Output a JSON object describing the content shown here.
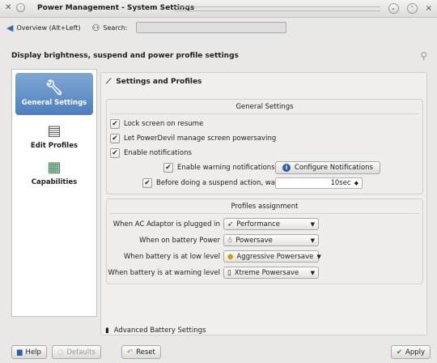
{
  "window": {
    "title": "Power Management - System Settings",
    "kde_icon": "kde-gear-icon",
    "pin_icon": "pin-icon",
    "minimize_symbol": "⌄",
    "maximize_symbol": "⌃",
    "close_symbol": "×"
  },
  "toolbar": {
    "overview_label": "Overview (Alt+Left)",
    "search_label": "Search:",
    "search_value": ""
  },
  "header": {
    "description": "Display brightness, suspend and power profile settings"
  },
  "sidebar": {
    "items": [
      {
        "label": "General Settings",
        "icon": "wrench-icon",
        "active": true
      },
      {
        "label": "Edit Profiles",
        "icon": "document-icon",
        "active": false
      },
      {
        "label": "Capabilities",
        "icon": "hardware-icon",
        "active": false
      }
    ]
  },
  "main": {
    "section_title": "Settings and Profiles",
    "general": {
      "title": "General Settings",
      "lock_screen": "Lock screen on resume",
      "powerdevil": "Let PowerDevil manage screen powersaving",
      "notifications": "Enable notifications",
      "warning_notifications": "Enable warning notifications",
      "configure_notifications": "Configure Notifications",
      "before_suspend": "Before doing a suspend action, wait",
      "wait_value": "10sec"
    },
    "profiles": {
      "title": "Profiles assignment",
      "rows": [
        {
          "label": "When AC Adaptor is plugged in",
          "value": "Performance",
          "icon": "rocket-icon"
        },
        {
          "label": "When on battery Power",
          "value": "Powersave",
          "icon": "lightbulb-icon"
        },
        {
          "label": "When battery is at low level",
          "value": "Aggressive Powersave",
          "icon": "warning-icon"
        },
        {
          "label": "When battery is at warning level",
          "value": "Xtreme Powersave",
          "icon": "battery-icon"
        }
      ]
    },
    "advanced": "Advanced Battery Settings"
  },
  "bottom": {
    "help": "Help",
    "defaults": "Defaults",
    "reset": "Reset",
    "apply": "Apply"
  },
  "colors": {
    "active_sidebar": "#5a8ac4",
    "info_blue": "#2e5fa8"
  }
}
